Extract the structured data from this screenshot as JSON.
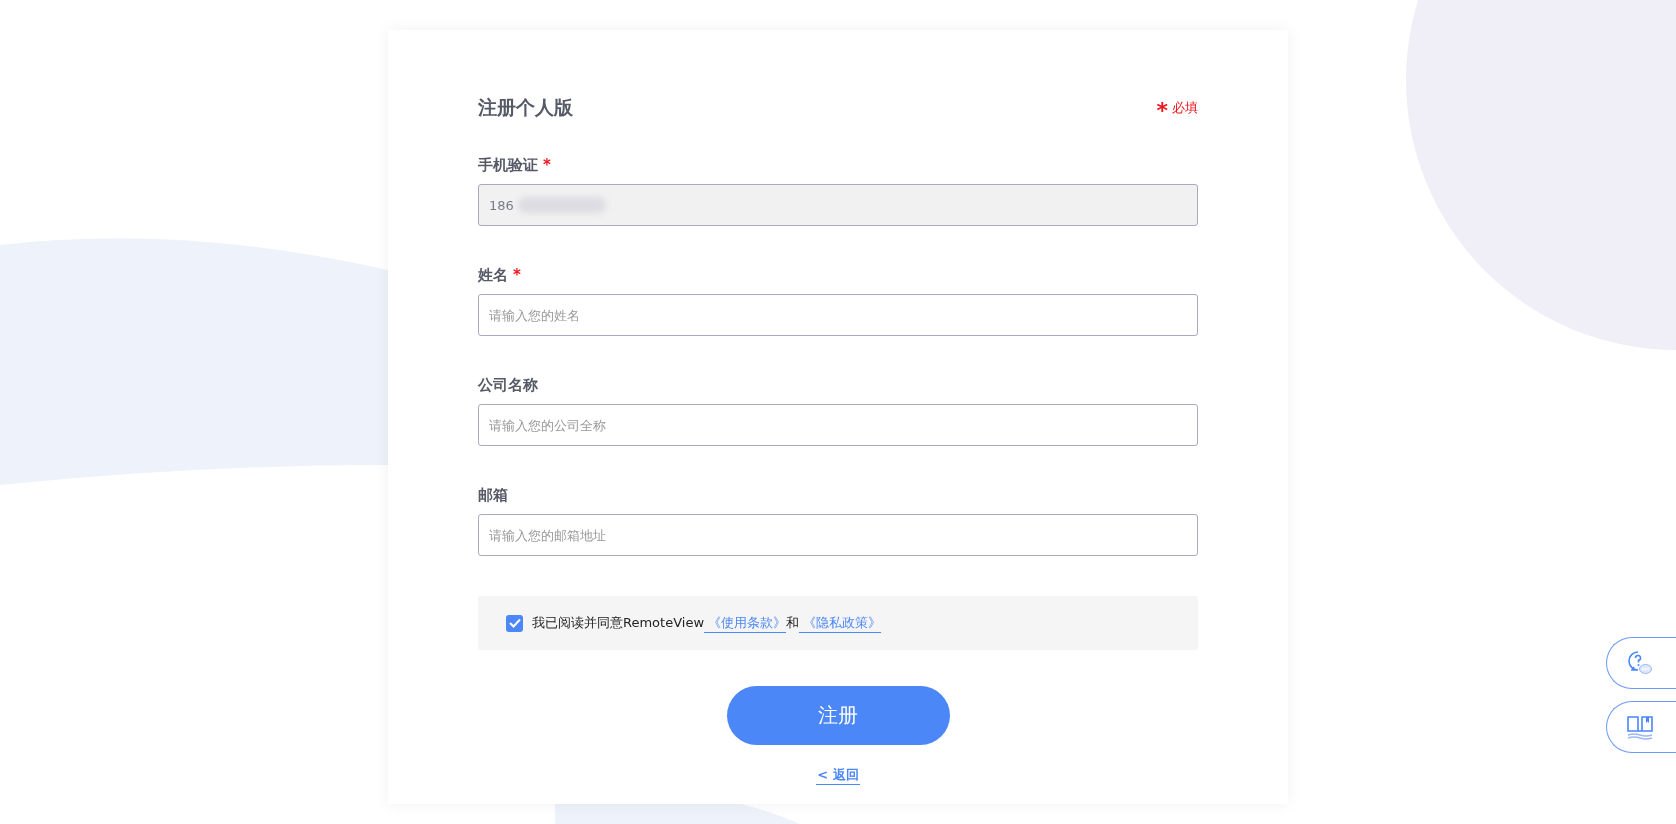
{
  "title": "注册个人版",
  "required_mark": "*",
  "legend": {
    "mark": "*",
    "text": "必填"
  },
  "fields": [
    {
      "label": "手机验证",
      "required": true,
      "disabled": true,
      "value": "186",
      "redacted": true
    },
    {
      "label": "姓名",
      "required": true,
      "disabled": false,
      "placeholder": "请输入您的姓名"
    },
    {
      "label": "公司名称",
      "required": false,
      "disabled": false,
      "placeholder": "请输入您的公司全称"
    },
    {
      "label": "邮箱",
      "required": false,
      "disabled": false,
      "placeholder": "请输入您的邮箱地址"
    }
  ],
  "agreement": {
    "checked": true,
    "text": "我已阅读并同意RemoteView",
    "terms_link": "《使用条款》",
    "conjunction": "和",
    "privacy_link": "《隐私政策》"
  },
  "submit": "注册",
  "back": "< 返回",
  "side_buttons": [
    {
      "kind": "help"
    },
    {
      "kind": "manual"
    }
  ]
}
